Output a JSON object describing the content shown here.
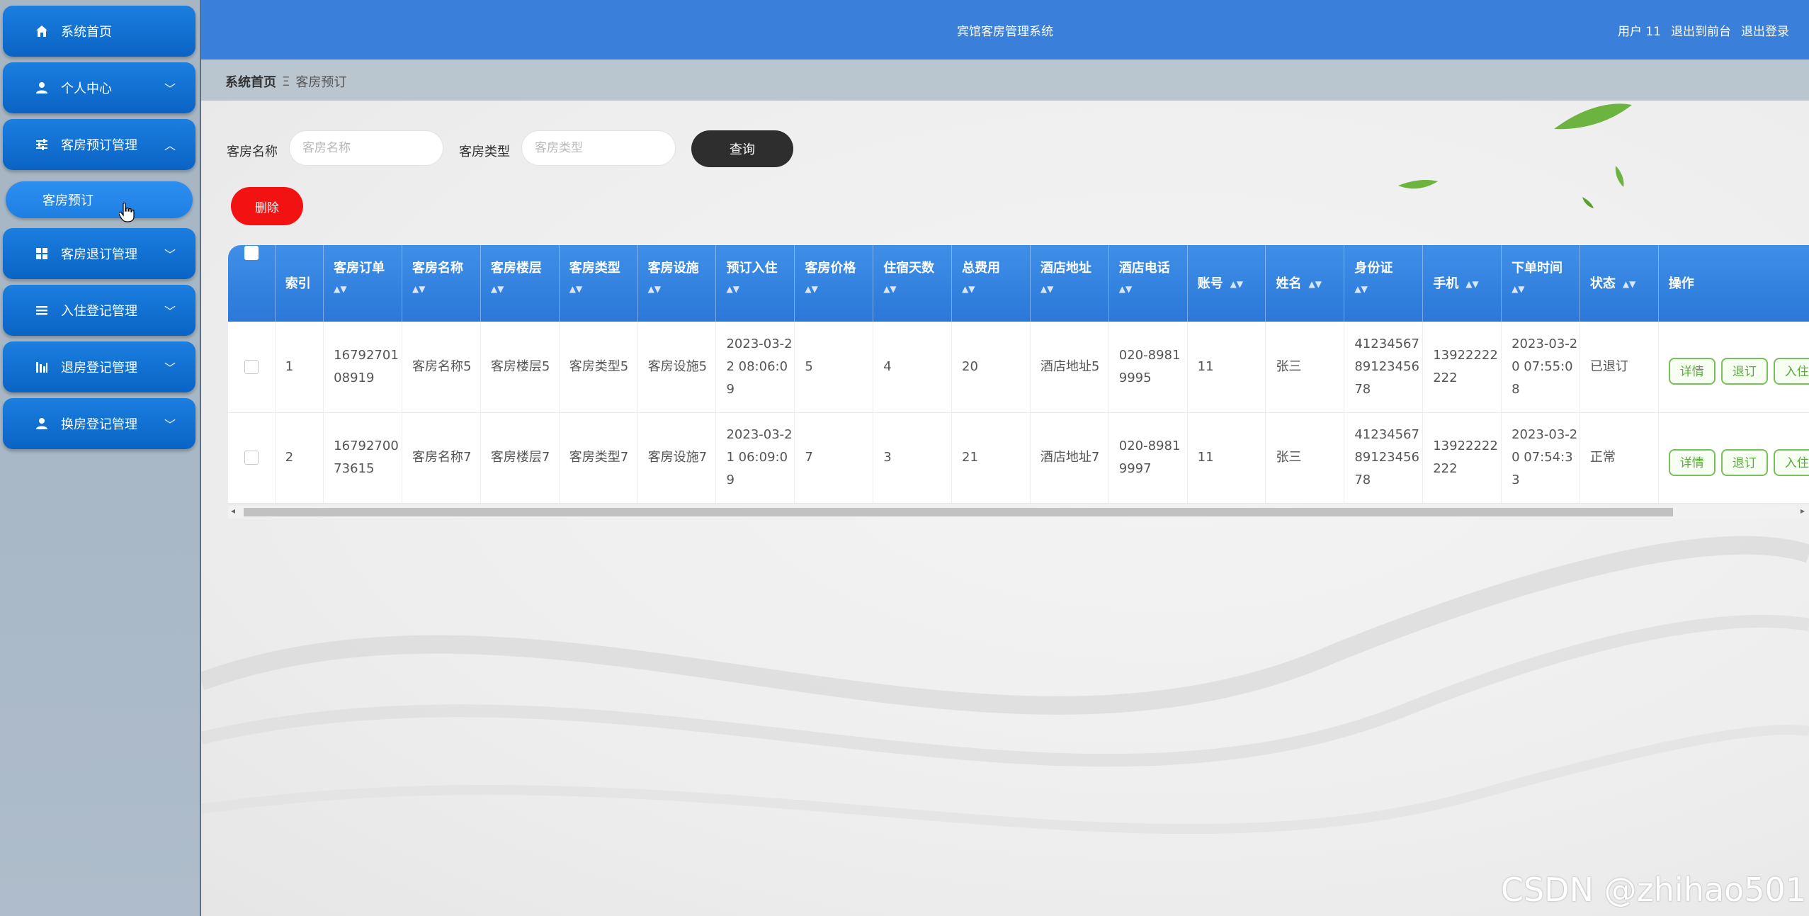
{
  "app": {
    "title": "宾馆客房管理系统"
  },
  "header": {
    "user": "用户 11",
    "to_front": "退出到前台",
    "logout": "退出登录"
  },
  "sidebar": {
    "items": [
      {
        "label": "系统首页",
        "icon": "home-icon"
      },
      {
        "label": "个人中心",
        "icon": "user-icon"
      },
      {
        "label": "客房预订管理",
        "icon": "sliders-icon"
      },
      {
        "label": "客房退订管理",
        "icon": "grid-icon"
      },
      {
        "label": "入住登记管理",
        "icon": "list-icon"
      },
      {
        "label": "退房登记管理",
        "icon": "bar-chart-icon"
      },
      {
        "label": "换房登记管理",
        "icon": "user-icon"
      }
    ],
    "subitem": "客房预订"
  },
  "breadcrumb": {
    "home": "系统首页",
    "separator": "Ξ",
    "current": "客房预订"
  },
  "filters": {
    "room_name_label": "客房名称",
    "room_name_placeholder": "客房名称",
    "room_type_label": "客房类型",
    "room_type_placeholder": "客房类型",
    "query": "查询",
    "delete": "删除"
  },
  "table": {
    "headers": [
      "索引",
      "客房订单",
      "客房名称",
      "客房楼层",
      "客房类型",
      "客房设施",
      "预订入住",
      "客房价格",
      "住宿天数",
      "总费用",
      "酒店地址",
      "酒店电话",
      "账号",
      "姓名",
      "身份证",
      "手机",
      "下单时间",
      "状态",
      "操作"
    ],
    "rows": [
      [
        "1",
        "1679270108919",
        "客房名称5",
        "客房楼层5",
        "客房类型5",
        "客房设施5",
        "2023-03-22 08:06:09",
        "5",
        "4",
        "20",
        "酒店地址5",
        "020-89819995",
        "11",
        "张三",
        "412345678912345678",
        "13922222222",
        "2023-03-20 07:55:08",
        "已退订"
      ],
      [
        "2",
        "1679270073615",
        "客房名称7",
        "客房楼层7",
        "客房类型7",
        "客房设施7",
        "2023-03-21 06:09:09",
        "7",
        "3",
        "21",
        "酒店地址7",
        "020-89819997",
        "11",
        "张三",
        "412345678912345678",
        "13922222222",
        "2023-03-20 07:54:33",
        "正常"
      ]
    ],
    "actions": [
      "详情",
      "退订",
      "入住"
    ]
  },
  "watermark": "CSDN @zhihao501"
}
